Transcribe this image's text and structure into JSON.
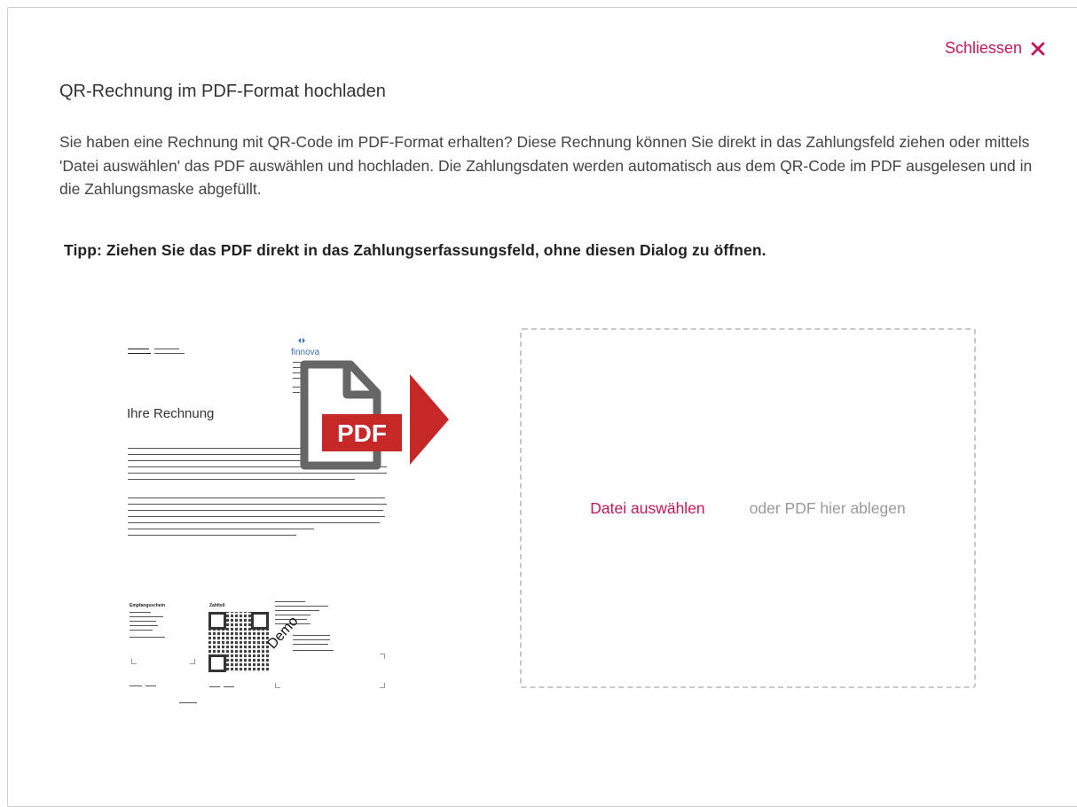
{
  "dialog": {
    "close_label": "Schliessen",
    "title": "QR-Rechnung im PDF-Format hochladen",
    "description": "Sie haben eine Rechnung mit QR-Code im PDF-Format erhalten? Diese Rechnung können Sie direkt in das Zahlungsfeld ziehen oder mittels 'Datei auswählen' das PDF auswählen und hochladen. Die Zahlungsdaten werden automatisch aus dem QR-Code im PDF ausgelesen und in die Zahlungsmaske abgefüllt.",
    "tip": "Tipp: Ziehen Sie das PDF direkt in das Zahlungserfassungsfeld, ohne diesen Dialog zu öffnen."
  },
  "illustration": {
    "invoice_heading": "Ihre Rechnung",
    "logo_text": "finnova",
    "pdf_badge": "PDF",
    "receipt_label": "Empfangsschein",
    "payment_label": "Zahlteil",
    "demo_stamp": "Demo"
  },
  "dropzone": {
    "choose_file": "Datei auswählen",
    "drop_hint": "oder PDF hier ablegen"
  },
  "colors": {
    "accent": "#c2185b",
    "pdf_red": "#c62828",
    "dropzone_border": "#c8c8c8"
  }
}
